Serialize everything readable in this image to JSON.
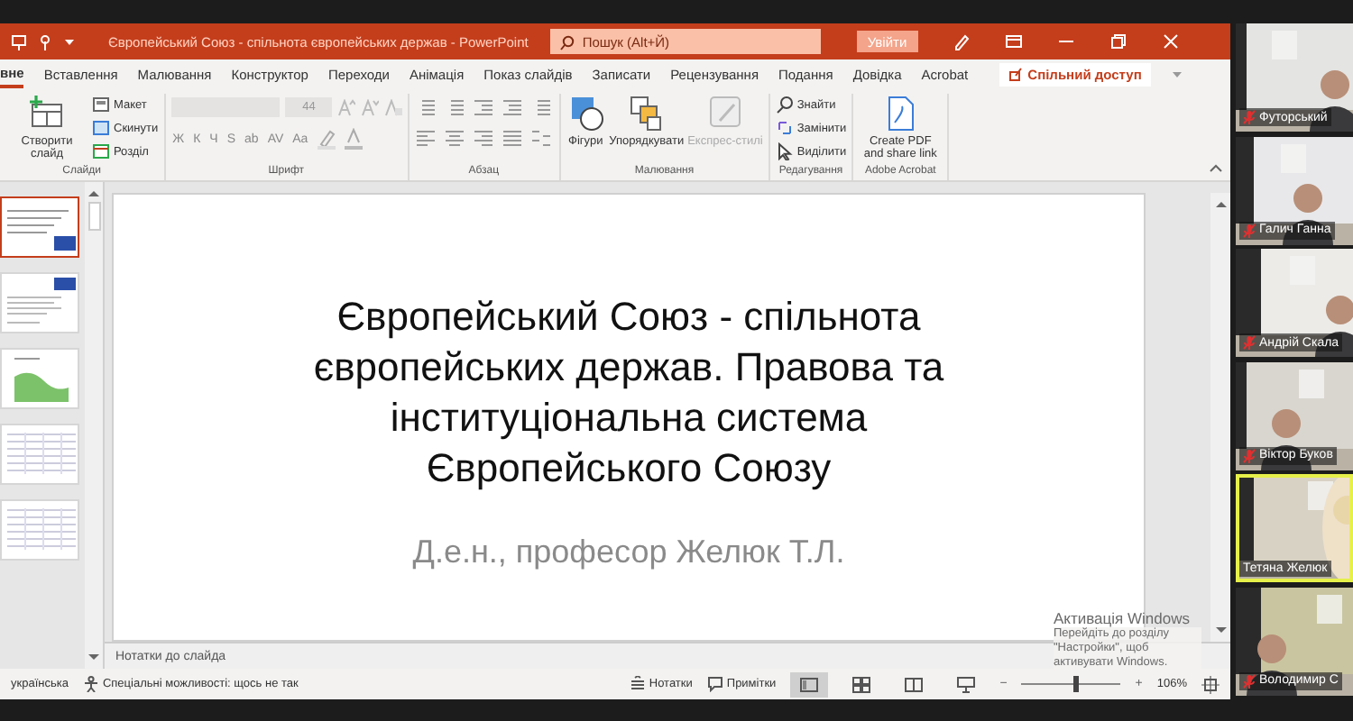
{
  "window": {
    "title": "Європейський Союз - спільнота європейських держав  -  PowerPoint",
    "search": {
      "placeholder": "Пошук (Alt+Й)"
    },
    "sign_in": "Увійти"
  },
  "tabs": [
    {
      "label": "вне",
      "selected": true
    },
    {
      "label": "Вставлення",
      "selected": false
    },
    {
      "label": "Малювання",
      "selected": false
    },
    {
      "label": "Конструктор",
      "selected": false
    },
    {
      "label": "Переходи",
      "selected": false
    },
    {
      "label": "Анімація",
      "selected": false
    },
    {
      "label": "Показ слайдів",
      "selected": false
    },
    {
      "label": "Записати",
      "selected": false
    },
    {
      "label": "Рецензування",
      "selected": false
    },
    {
      "label": "Подання",
      "selected": false
    },
    {
      "label": "Довідка",
      "selected": false
    },
    {
      "label": "Acrobat",
      "selected": false
    }
  ],
  "share_button": "Спільний доступ",
  "ribbon": [
    {
      "label": "Слайди",
      "items": [
        {
          "kind": "big",
          "label": "Створити слайд",
          "disabled": false
        },
        {
          "kind": "small",
          "label": "Макет",
          "disabled": false
        },
        {
          "kind": "small",
          "label": "Скинути",
          "disabled": false
        },
        {
          "kind": "small",
          "label": "Розділ",
          "disabled": false
        }
      ]
    },
    {
      "label": "Шрифт",
      "items": [
        {
          "kind": "font",
          "size": "44",
          "glyphs": [
            "Ж",
            "К",
            "Ч",
            "S",
            "ab",
            "AV",
            "Aa"
          ]
        }
      ]
    },
    {
      "label": "Абзац",
      "items": [
        {
          "kind": "paragraph"
        }
      ]
    },
    {
      "label": "Малювання",
      "items": [
        {
          "kind": "big",
          "label": "Фігури",
          "disabled": false
        },
        {
          "kind": "big",
          "label": "Упорядкувати",
          "disabled": false
        },
        {
          "kind": "big",
          "label": "Експрес-стилі",
          "disabled": true
        }
      ]
    },
    {
      "label": "Редагування",
      "items": [
        {
          "kind": "small",
          "label": "Знайти",
          "disabled": false
        },
        {
          "kind": "small",
          "label": "Замінити",
          "disabled": false
        },
        {
          "kind": "small",
          "label": "Виділити",
          "disabled": false
        }
      ]
    },
    {
      "label": "Adobe Acrobat",
      "items": [
        {
          "kind": "big",
          "label": "Create PDF and share link",
          "disabled": false
        }
      ]
    }
  ],
  "thumbnails": [
    {
      "kind": "title",
      "selected": true
    },
    {
      "kind": "text",
      "selected": false
    },
    {
      "kind": "map",
      "selected": false
    },
    {
      "kind": "table",
      "selected": false
    },
    {
      "kind": "table",
      "selected": false
    }
  ],
  "slide": {
    "title": "Європейський Союз - спільнота європейських держав. Правова та інституціональна система Європейського Союзу",
    "subtitle": "Д.е.н., професор Желюк Т.Л."
  },
  "notes": "Нотатки до слайда",
  "status_bar": {
    "language": "українська",
    "accessibility": "Спеціальні можливості: щось не так",
    "notes_button": "Нотатки",
    "comments_button": "Примітки",
    "views": [
      {
        "selected": true
      },
      {
        "selected": false
      },
      {
        "selected": false
      },
      {
        "selected": false
      }
    ],
    "zoom": {
      "minus": "−",
      "plus": "+",
      "level": 0.55,
      "reading": "106%"
    }
  },
  "participants": [
    {
      "name": "Футорський",
      "muted": true,
      "speaking": false
    },
    {
      "name": "Галич Ганна",
      "muted": true,
      "speaking": false
    },
    {
      "name": "Андрій Скала",
      "muted": true,
      "speaking": false
    },
    {
      "name": "Віктор Буков",
      "muted": true,
      "speaking": false
    },
    {
      "name": "Тетяна Желюк",
      "muted": false,
      "speaking": true
    },
    {
      "name": "Володимир С",
      "muted": true,
      "speaking": false
    }
  ],
  "activation": {
    "title": "Активація Windows",
    "text": "Перейдіть до розділу \"Настройки\", щоб активувати Windows."
  }
}
